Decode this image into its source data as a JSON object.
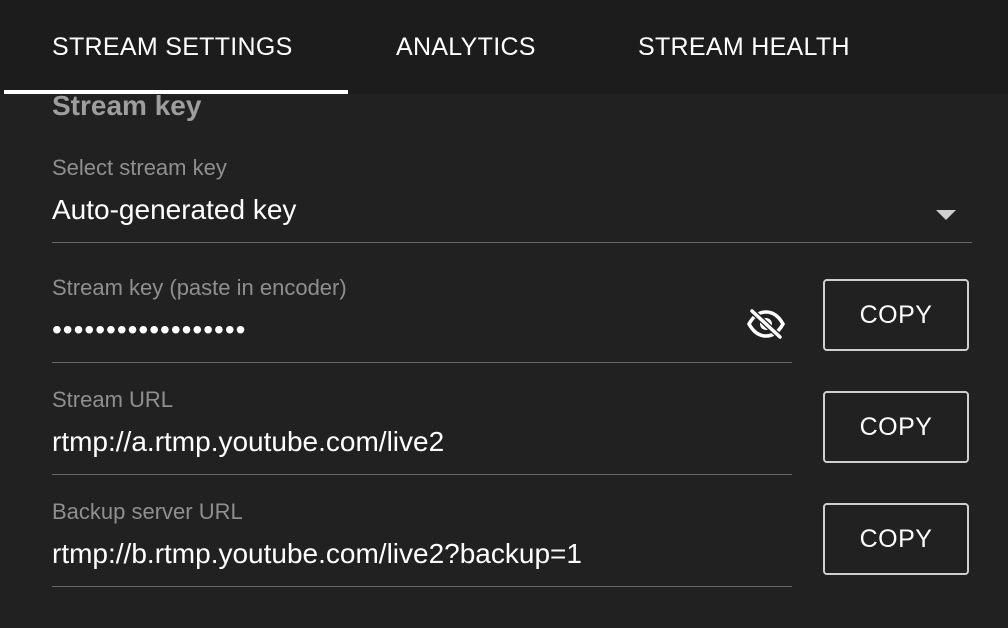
{
  "tabs": [
    {
      "label": "STREAM SETTINGS",
      "active": true
    },
    {
      "label": "ANALYTICS",
      "active": false
    },
    {
      "label": "STREAM HEALTH",
      "active": false
    }
  ],
  "section": {
    "title": "Stream key"
  },
  "select_key": {
    "label": "Select stream key",
    "value": "Auto-generated key",
    "icon": "dropdown-arrow-icon"
  },
  "stream_key": {
    "label": "Stream key (paste in encoder)",
    "value": "••••••••••••••••••",
    "visibility_icon": "eye-off-icon",
    "copy_label": "COPY"
  },
  "stream_url": {
    "label": "Stream URL",
    "value": "rtmp://a.rtmp.youtube.com/live2",
    "copy_label": "COPY"
  },
  "backup_url": {
    "label": "Backup server URL",
    "value": "rtmp://b.rtmp.youtube.com/live2?backup=1",
    "copy_label": "COPY"
  },
  "colors": {
    "background": "#212121",
    "tabbar": "#1c1c1c",
    "label": "#8f8f8f",
    "text": "#ffffff"
  }
}
